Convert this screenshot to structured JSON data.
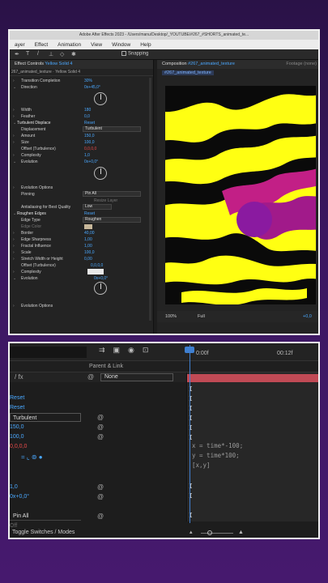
{
  "app": {
    "title": "Adobe After Effects 2023 - /Users/manu/Desktop/_YOUTUBE/#267_#SHORTS_animated_te...",
    "menu": [
      "ayer",
      "Effect",
      "Animation",
      "View",
      "Window",
      "Help"
    ],
    "snapping_label": "Snapping"
  },
  "effect_controls": {
    "tab_label": "Effect Controls",
    "layer_name": "Yellow Solid 4",
    "subtitle": "267_animated_texture · Yellow Solid 4",
    "rows": [
      {
        "label": "Transition Completion",
        "value": "30%"
      },
      {
        "label": "Direction",
        "value": "0x+45,0°"
      },
      {
        "label": "Width",
        "value": "180"
      },
      {
        "label": "Feather",
        "value": "0,0"
      },
      {
        "label": "Turbulent Displace",
        "value": "Reset"
      },
      {
        "label": "Displacement",
        "value": "Turbulent"
      },
      {
        "label": "Amount",
        "value": "150,0"
      },
      {
        "label": "Size",
        "value": "100,0"
      },
      {
        "label": "Offset (Turbulence)",
        "value": "0,0,0,0"
      },
      {
        "label": "Complexity",
        "value": "1,0"
      },
      {
        "label": "Evolution",
        "value": "0x+0,0°"
      },
      {
        "label": "Evolution Options",
        "value": ""
      },
      {
        "label": "Pinning",
        "value": "Pin All"
      },
      {
        "label": "Resize Layer",
        "value": ""
      },
      {
        "label": "Antialiasing for Best Quality",
        "value": "Low"
      },
      {
        "label": "Roughen Edges",
        "value": "Reset"
      },
      {
        "label": "Edge Type",
        "value": "Roughen"
      },
      {
        "label": "Edge Color",
        "value": ""
      },
      {
        "label": "Border",
        "value": "40,00"
      },
      {
        "label": "Edge Sharpness",
        "value": "1,00"
      },
      {
        "label": "Fractal Influence",
        "value": "1,00"
      },
      {
        "label": "Scale",
        "value": "100,0"
      },
      {
        "label": "Stretch Width or Height",
        "value": "0,00"
      },
      {
        "label": "Offset (Turbulence)",
        "value": "0,0,0,0"
      },
      {
        "label": "Complexity",
        "value": ""
      },
      {
        "label": "Evolution",
        "value": "0x+0,0°"
      },
      {
        "label": "Evolution Options",
        "value": ""
      }
    ]
  },
  "composition": {
    "tab_label": "Composition",
    "comp_name": "#267_animated_texture",
    "footage_label": "Footage (none)",
    "breadcrumb": "#267_animated_texture",
    "zoom": "100%",
    "resolution": "Full",
    "exposure": "+0,0"
  },
  "timeline": {
    "ruler_start": "0:00f",
    "ruler_mid": "00:12f",
    "parent_link_label": "Parent & Link",
    "parent_value": "None",
    "rows": [
      {
        "text": "Reset",
        "color": "blue"
      },
      {
        "text": "Reset",
        "color": "blue"
      },
      {
        "text": "Turbulent",
        "color": "white"
      },
      {
        "text": "150,0",
        "color": "blue"
      },
      {
        "text": "100,0",
        "color": "blue"
      },
      {
        "text": "0,0,0,0",
        "color": "red"
      },
      {
        "text": "1,0",
        "color": "blue"
      },
      {
        "text": "0x+0,0°",
        "color": "blue"
      },
      {
        "text": "Pin All",
        "color": "white"
      },
      {
        "text": "Off",
        "color": "white"
      }
    ],
    "expression_lines": [
      "x = time*-100;",
      "y = time*100;",
      "[x,y]"
    ],
    "status_label": "Toggle Switches / Modes"
  }
}
